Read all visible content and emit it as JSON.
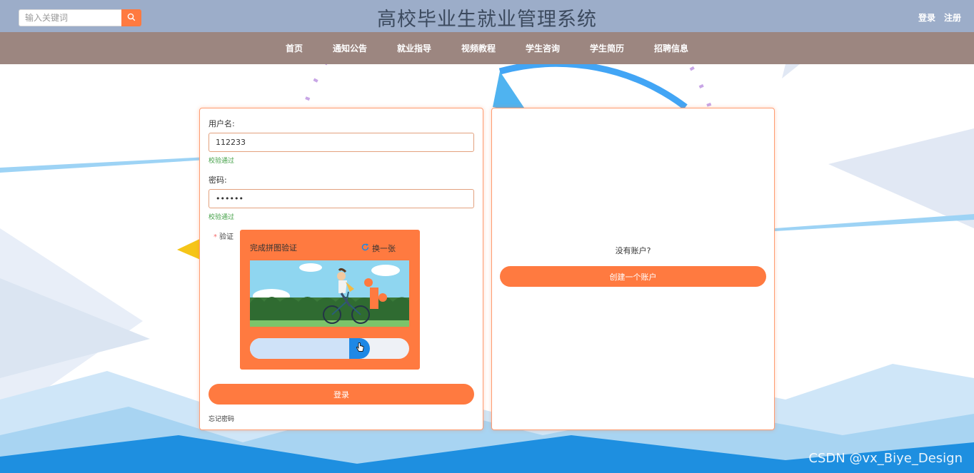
{
  "header": {
    "search_placeholder": "输入关键词",
    "site_title": "高校毕业生就业管理系统",
    "login_link": "登录",
    "register_link": "注册"
  },
  "nav": [
    "首页",
    "通知公告",
    "就业指导",
    "视频教程",
    "学生咨询",
    "学生简历",
    "招聘信息"
  ],
  "login_form": {
    "username_label": "用户名:",
    "username_value": "112233",
    "username_status": "校验通过",
    "password_label": "密码:",
    "password_value": "••••••",
    "password_status": "校验通过",
    "verify_label": "验证",
    "verify_required_mark": "*",
    "captcha": {
      "title": "完成拼图验证",
      "refresh_label": "换一张",
      "slider_progress": 0.69
    },
    "submit_label": "登录",
    "forgot_label": "忘记密码"
  },
  "register_panel": {
    "prompt": "没有账户?",
    "create_label": "创建一个账户"
  },
  "watermark": "CSDN @vx_Biye_Design",
  "colors": {
    "accent": "#ff7a40",
    "topbar": "#9cadc9",
    "navbar": "#9c8680",
    "success": "#43a047",
    "slider_thumb": "#1e88e5"
  },
  "icons": {
    "search": "search-icon",
    "refresh": "refresh-icon",
    "slider": "hand-pointer-icon"
  }
}
